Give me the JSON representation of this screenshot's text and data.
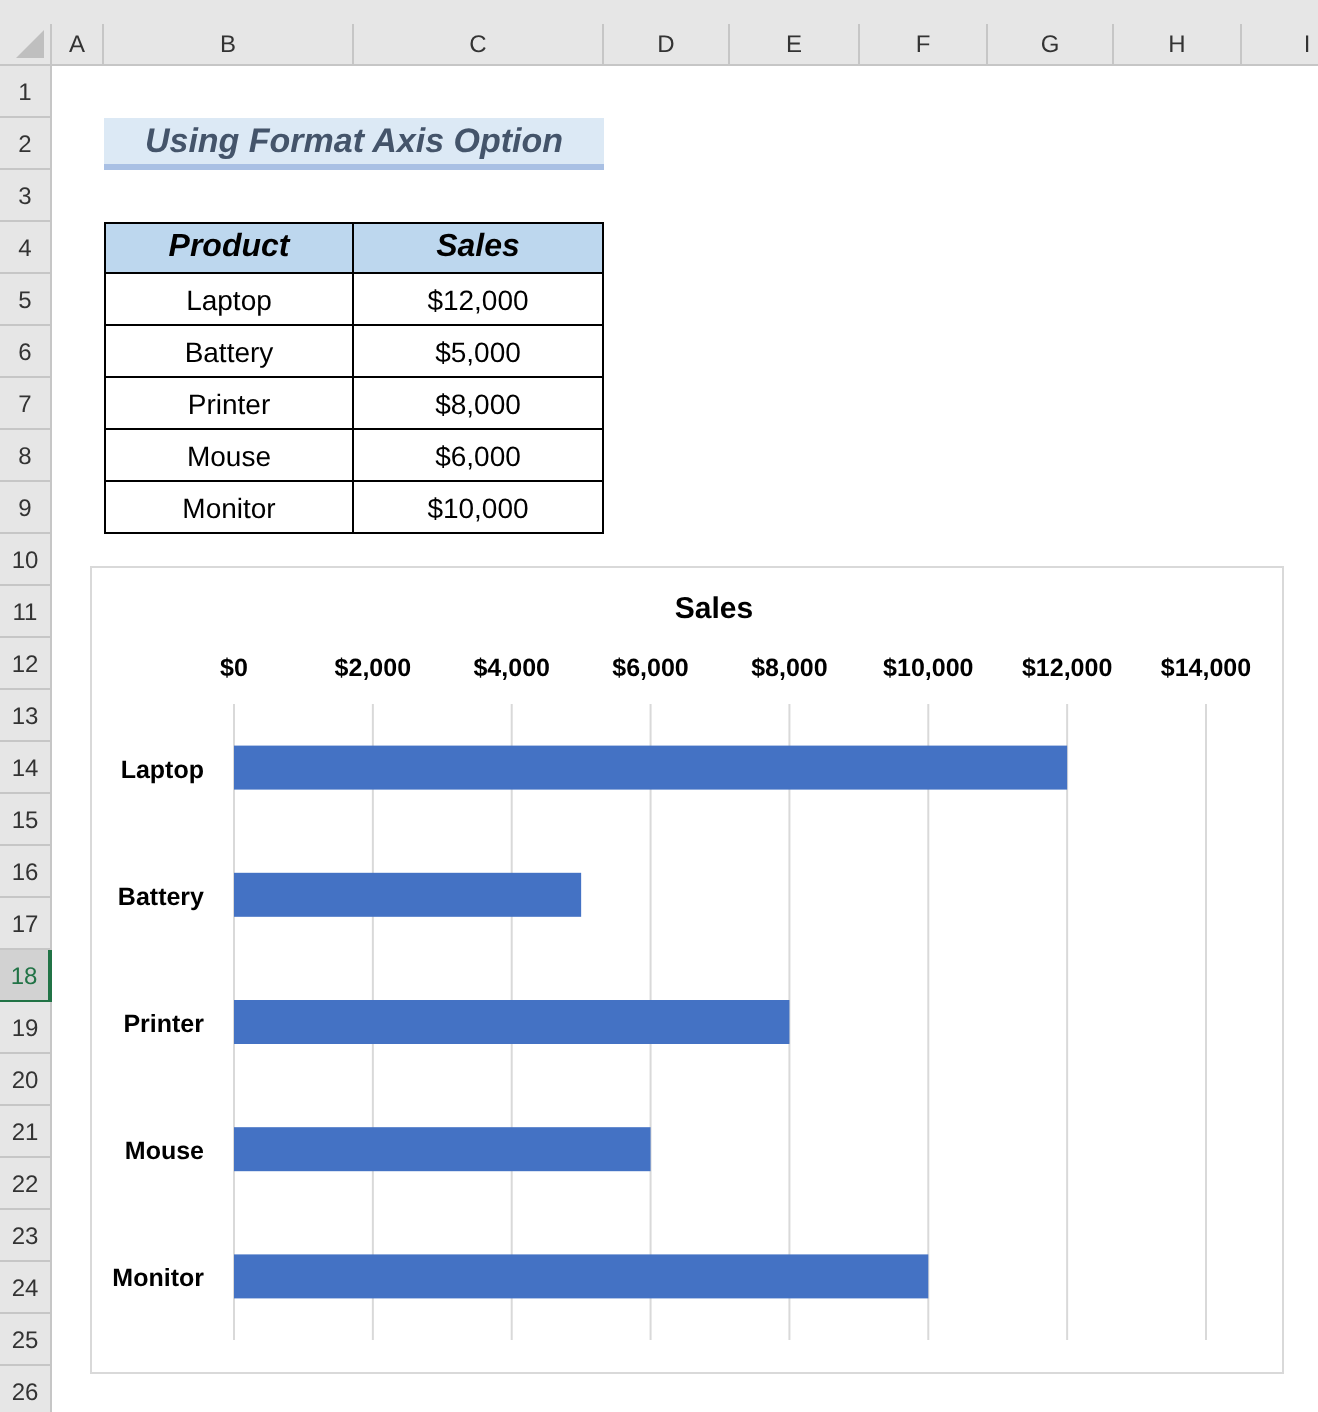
{
  "columns": [
    {
      "label": "A",
      "selected": false
    },
    {
      "label": "B",
      "selected": false
    },
    {
      "label": "C",
      "selected": false
    },
    {
      "label": "D",
      "selected": false
    },
    {
      "label": "E",
      "selected": false
    },
    {
      "label": "F",
      "selected": false
    },
    {
      "label": "G",
      "selected": false
    },
    {
      "label": "H",
      "selected": false
    },
    {
      "label": "I",
      "selected": false
    }
  ],
  "rows": [
    {
      "label": "1",
      "selected": false
    },
    {
      "label": "2",
      "selected": false
    },
    {
      "label": "3",
      "selected": false
    },
    {
      "label": "4",
      "selected": false
    },
    {
      "label": "5",
      "selected": false
    },
    {
      "label": "6",
      "selected": false
    },
    {
      "label": "7",
      "selected": false
    },
    {
      "label": "8",
      "selected": false
    },
    {
      "label": "9",
      "selected": false
    },
    {
      "label": "10",
      "selected": false
    },
    {
      "label": "11",
      "selected": false
    },
    {
      "label": "12",
      "selected": false
    },
    {
      "label": "13",
      "selected": false
    },
    {
      "label": "14",
      "selected": false
    },
    {
      "label": "15",
      "selected": false
    },
    {
      "label": "16",
      "selected": false
    },
    {
      "label": "17",
      "selected": false
    },
    {
      "label": "18",
      "selected": true
    },
    {
      "label": "19",
      "selected": false
    },
    {
      "label": "20",
      "selected": false
    },
    {
      "label": "21",
      "selected": false
    },
    {
      "label": "22",
      "selected": false
    },
    {
      "label": "23",
      "selected": false
    },
    {
      "label": "24",
      "selected": false
    },
    {
      "label": "25",
      "selected": false
    },
    {
      "label": "26",
      "selected": false
    }
  ],
  "title": "Using Format Axis Option",
  "table": {
    "columns": [
      "Product",
      "Sales"
    ],
    "rows": [
      [
        "Laptop",
        "$12,000"
      ],
      [
        "Battery",
        "$5,000"
      ],
      [
        "Printer",
        "$8,000"
      ],
      [
        "Mouse",
        "$6,000"
      ],
      [
        "Monitor",
        "$10,000"
      ]
    ]
  },
  "chart": {
    "chart_data": {
      "type": "bar",
      "orientation": "horizontal",
      "title": "Sales",
      "categories": [
        "Laptop",
        "Battery",
        "Printer",
        "Mouse",
        "Monitor"
      ],
      "series": [
        {
          "color": "#4472c4",
          "values": [
            12000,
            5000,
            8000,
            6000,
            10000
          ]
        }
      ],
      "grid": true,
      "xlim": [
        0,
        14000
      ],
      "xticks": [
        {
          "value": 0,
          "label": "$0"
        },
        {
          "value": 2000,
          "label": "$2,000"
        },
        {
          "value": 4000,
          "label": "$4,000"
        },
        {
          "value": 6000,
          "label": "$6,000"
        },
        {
          "value": 8000,
          "label": "$8,000"
        },
        {
          "value": 10000,
          "label": "$10,000"
        },
        {
          "value": 12000,
          "label": "$12,000"
        },
        {
          "value": 14000,
          "label": "$14,000"
        }
      ]
    }
  }
}
